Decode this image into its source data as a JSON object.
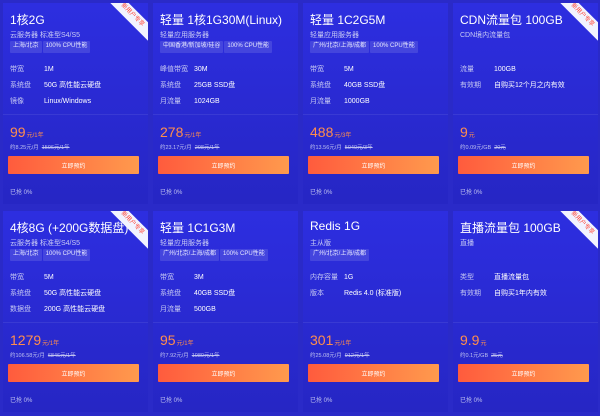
{
  "cards": [
    {
      "title": "1核2G",
      "subtitle": "云服务器 标准型S4/S5",
      "tags": [
        "上海/北京",
        "100% CPU性能"
      ],
      "specs": [
        {
          "key": "带宽",
          "value": "1M"
        },
        {
          "key": "系统盘",
          "value": "50G 高性能云硬盘"
        },
        {
          "key": "镜像",
          "value": "Linux/Windows"
        }
      ],
      "price": "99",
      "price_unit": "元/1年",
      "monthly": "约8.25元/月",
      "orig": "1596元/1年",
      "button": "立即预约",
      "sold": "已抢 0%",
      "ribbon": "新用户专享"
    },
    {
      "title": "轻量 1核1G30M(Linux)",
      "subtitle": "轻量应用服务器",
      "tags": [
        "中国香港/新加坡/硅谷",
        "100% CPU性能"
      ],
      "specs": [
        {
          "key": "峰值带宽",
          "value": "30M"
        },
        {
          "key": "系统盘",
          "value": "25GB SSD盘"
        },
        {
          "key": "月流量",
          "value": "1024GB"
        }
      ],
      "price": "278",
      "price_unit": "元/1年",
      "monthly": "约23.17元/月",
      "orig": "298元/1年",
      "button": "立即预约",
      "sold": "已抢 0%"
    },
    {
      "title": "轻量 1C2G5M",
      "subtitle": "轻量应用服务器",
      "tags": [
        "广州/北京/上海/成都",
        "100% CPU性能"
      ],
      "specs": [
        {
          "key": "带宽",
          "value": "5M"
        },
        {
          "key": "系统盘",
          "value": "40GB SSD盘"
        },
        {
          "key": "月流量",
          "value": "1000GB"
        }
      ],
      "price": "488",
      "price_unit": "元/3年",
      "monthly": "约13.56元/月",
      "orig": "5040元/3年",
      "button": "立即预约",
      "sold": "已抢 0%"
    },
    {
      "title": "CDN流量包 100GB",
      "subtitle": "CDN境内流量包",
      "tags": [],
      "specs": [
        {
          "key": "流量",
          "value": "100GB"
        },
        {
          "key": "有效期",
          "value": "自购买12个月之内有效"
        }
      ],
      "price": "9",
      "price_unit": "元",
      "monthly": "约0.09元/GB",
      "orig": "20元",
      "button": "立即预约",
      "sold": "已抢 0%",
      "ribbon": "新用户专享"
    },
    {
      "title": "4核8G (+200G数据盘)",
      "subtitle": "云服务器 标准型S4/S5",
      "tags": [
        "上海/北京",
        "100% CPU性能"
      ],
      "specs": [
        {
          "key": "带宽",
          "value": "5M"
        },
        {
          "key": "系统盘",
          "value": "50G 高性能云硬盘"
        },
        {
          "key": "数据盘",
          "value": "200G 高性能云硬盘"
        }
      ],
      "price": "1279",
      "price_unit": "元/1年",
      "monthly": "约106.58元/月",
      "orig": "6846元/1年",
      "button": "立即预约",
      "sold": "已抢 0%",
      "ribbon": "新用户专享"
    },
    {
      "title": "轻量 1C1G3M",
      "subtitle": "轻量应用服务器",
      "tags": [
        "广州/北京/上海/成都",
        "100% CPU性能"
      ],
      "specs": [
        {
          "key": "带宽",
          "value": "3M"
        },
        {
          "key": "系统盘",
          "value": "40GB SSD盘"
        },
        {
          "key": "月流量",
          "value": "500GB"
        }
      ],
      "price": "95",
      "price_unit": "元/1年",
      "monthly": "约7.92元/月",
      "orig": "1080元/1年",
      "button": "立即预约",
      "sold": "已抢 0%"
    },
    {
      "title": "Redis 1G",
      "subtitle": "主从版",
      "tags": [
        "广州/北京/上海/成都"
      ],
      "specs": [
        {
          "key": "内存容量",
          "value": "1G"
        },
        {
          "key": "版本",
          "value": "Redis 4.0 (标准版)"
        }
      ],
      "price": "301",
      "price_unit": "元/1年",
      "monthly": "约25.08元/月",
      "orig": "912元/1年",
      "button": "立即预约",
      "sold": "已抢 0%"
    },
    {
      "title": "直播流量包 100GB",
      "subtitle": "直播",
      "tags": [],
      "specs": [
        {
          "key": "类型",
          "value": "直播流量包"
        },
        {
          "key": "有效期",
          "value": "自购买1年内有效"
        }
      ],
      "price": "9.9",
      "price_unit": "元",
      "monthly": "约0.1元/GB",
      "orig": "25元",
      "button": "立即预约",
      "sold": "已抢 0%",
      "ribbon": "新用户专享"
    }
  ]
}
